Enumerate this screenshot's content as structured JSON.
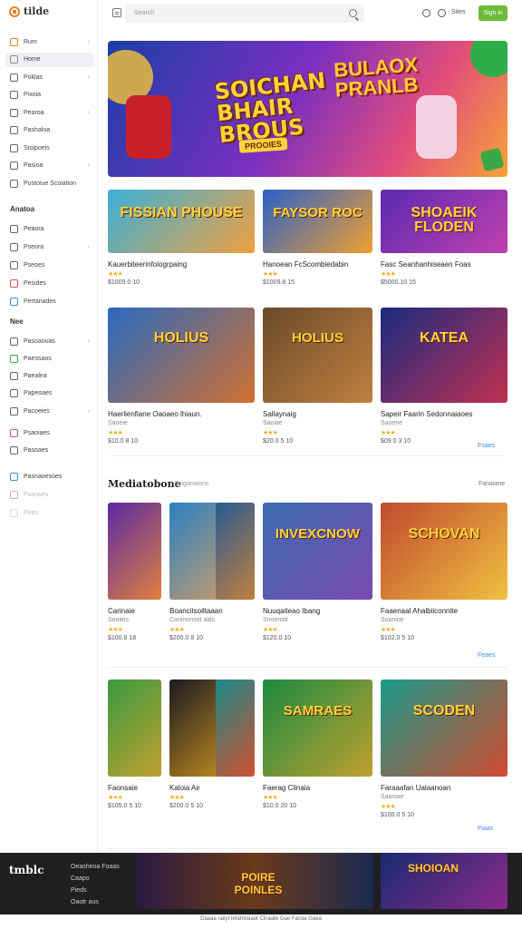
{
  "app": {
    "logo": "tilde"
  },
  "topbar": {
    "search_placeholder": "Search",
    "link": "Sites",
    "signin": "Sign in"
  },
  "sidebar": {
    "group1": [
      {
        "label": "Rum",
        "color": "#e8822a",
        "chev": true
      },
      {
        "label": "Home",
        "color": "#888",
        "active": true
      },
      {
        "label": "Poklas",
        "color": "#666",
        "chev": true
      },
      {
        "label": "Pixoia",
        "color": "#666"
      },
      {
        "label": "Pearoa",
        "color": "#666",
        "chev": true
      },
      {
        "label": "Pashaloa",
        "color": "#666"
      },
      {
        "label": "Stoipoeis",
        "color": "#666"
      },
      {
        "label": "Pasioa",
        "color": "#666",
        "chev": true
      },
      {
        "label": "Pustoiue Scoiation",
        "color": "#666"
      }
    ],
    "group2_title": "Anatoa",
    "group2": [
      {
        "label": "Peaora",
        "color": "#666"
      },
      {
        "label": "Pseora",
        "color": "#666",
        "chev": true
      },
      {
        "label": "Pseoes",
        "color": "#666"
      },
      {
        "label": "Pesides",
        "color": "#d9534f"
      },
      {
        "label": "Pertanades",
        "color": "#3a8ee6"
      }
    ],
    "group3_title": "Nee",
    "group3": [
      {
        "label": "Pasoaouas",
        "color": "#666",
        "chev": true
      },
      {
        "label": "Paessaos",
        "color": "#3aa845"
      },
      {
        "label": "Paealea",
        "color": "#666"
      },
      {
        "label": "Papeoaes",
        "color": "#666"
      },
      {
        "label": "Pacoeies",
        "color": "#666",
        "chev": true
      }
    ],
    "group4": [
      {
        "label": "Psaoiaes",
        "color": "#c050c0"
      },
      {
        "label": "Pasoaes",
        "color": "#666"
      }
    ],
    "group5": [
      {
        "label": "Pasnaoesoes",
        "color": "#3a8ee6"
      },
      {
        "label": "Pasnoes",
        "color": "#bbb"
      },
      {
        "label": "Peas",
        "color": "#ddd"
      }
    ]
  },
  "hero": {
    "title_left": "SOICHAN BHAIR BROUS",
    "title_right": "BULAOX PRANLB",
    "badge": "PROOIES"
  },
  "row1": [
    {
      "title": "Kauerbiteerinfologrpaing",
      "meta": "$1009.0 10",
      "art": "FISSIAN PHOUSE"
    },
    {
      "title": "Hanoean FcScombiedabin",
      "meta": "$1009.8 15",
      "art": "FAYSOR ROC"
    },
    {
      "title": "Fasc Seanhanhiseaen Foas",
      "meta": "$5000.10 15",
      "art": "SHOAEIK FLODEN"
    }
  ],
  "row2": [
    {
      "title": "Haerlienfiane Oaoaeo lhiaun.",
      "sub": "Saoeie",
      "meta": "$10.0 8 10",
      "art": "HOLIUS"
    },
    {
      "title": "Sallaynaig",
      "sub": "Saoiae",
      "meta": "$20.0 5 10",
      "art": "HOLIUS"
    },
    {
      "title": "Sapeir Faarin Sedonnaiaoes",
      "sub": "Saoene",
      "meta": "$09.0 3 10",
      "art": "KATEA"
    }
  ],
  "row2_more": "Fsaes",
  "section": {
    "title": "Mediatobone",
    "sub": "Sniganaions",
    "link": "Fanaiane"
  },
  "row3": [
    {
      "title": "Carinaie",
      "sub": "Sooieis",
      "meta": "$100.8 18"
    },
    {
      "title": "Boancitsoiltaaan",
      "sub": "Caninonsot aids",
      "meta": "$200.0 8 10"
    },
    {
      "title": "Nuuqaiteao Ibang",
      "sub": "Snoenstr",
      "meta": "$120.0 10",
      "art": "INVEXCNOW"
    },
    {
      "title": "Faaenaal Ahalbiiconnite",
      "sub": "Soanioe",
      "meta": "$102.0 5 10",
      "art": "SCHOVAN"
    }
  ],
  "row3_more": "Feaes",
  "row4": [
    {
      "title": "Faonsaie",
      "meta": "$105.0 5 10"
    },
    {
      "title": "Kaloia Air",
      "meta": "$200.0 5 10"
    },
    {
      "title": "Faerag Clinaia",
      "meta": "$10.0 20 10",
      "art": "SAMRAES"
    },
    {
      "title": "Faraaafan Ualaanoan",
      "sub": "Saaniae",
      "meta": "$100.0 5 10",
      "art": "SCODEN"
    }
  ],
  "row4_more": "Fiaas",
  "footer": {
    "logo": "tmblc",
    "links": [
      "Oeasheoa Foaas",
      "Caapo",
      "Pieds",
      "Oaotr aus"
    ],
    "banner_left": "POIRE POINLES",
    "banner_right": "SHOIOAN",
    "copyright": "Daaaa raiiyt Iefatnnaaot Cinaate Gae Facoa Gaea"
  }
}
